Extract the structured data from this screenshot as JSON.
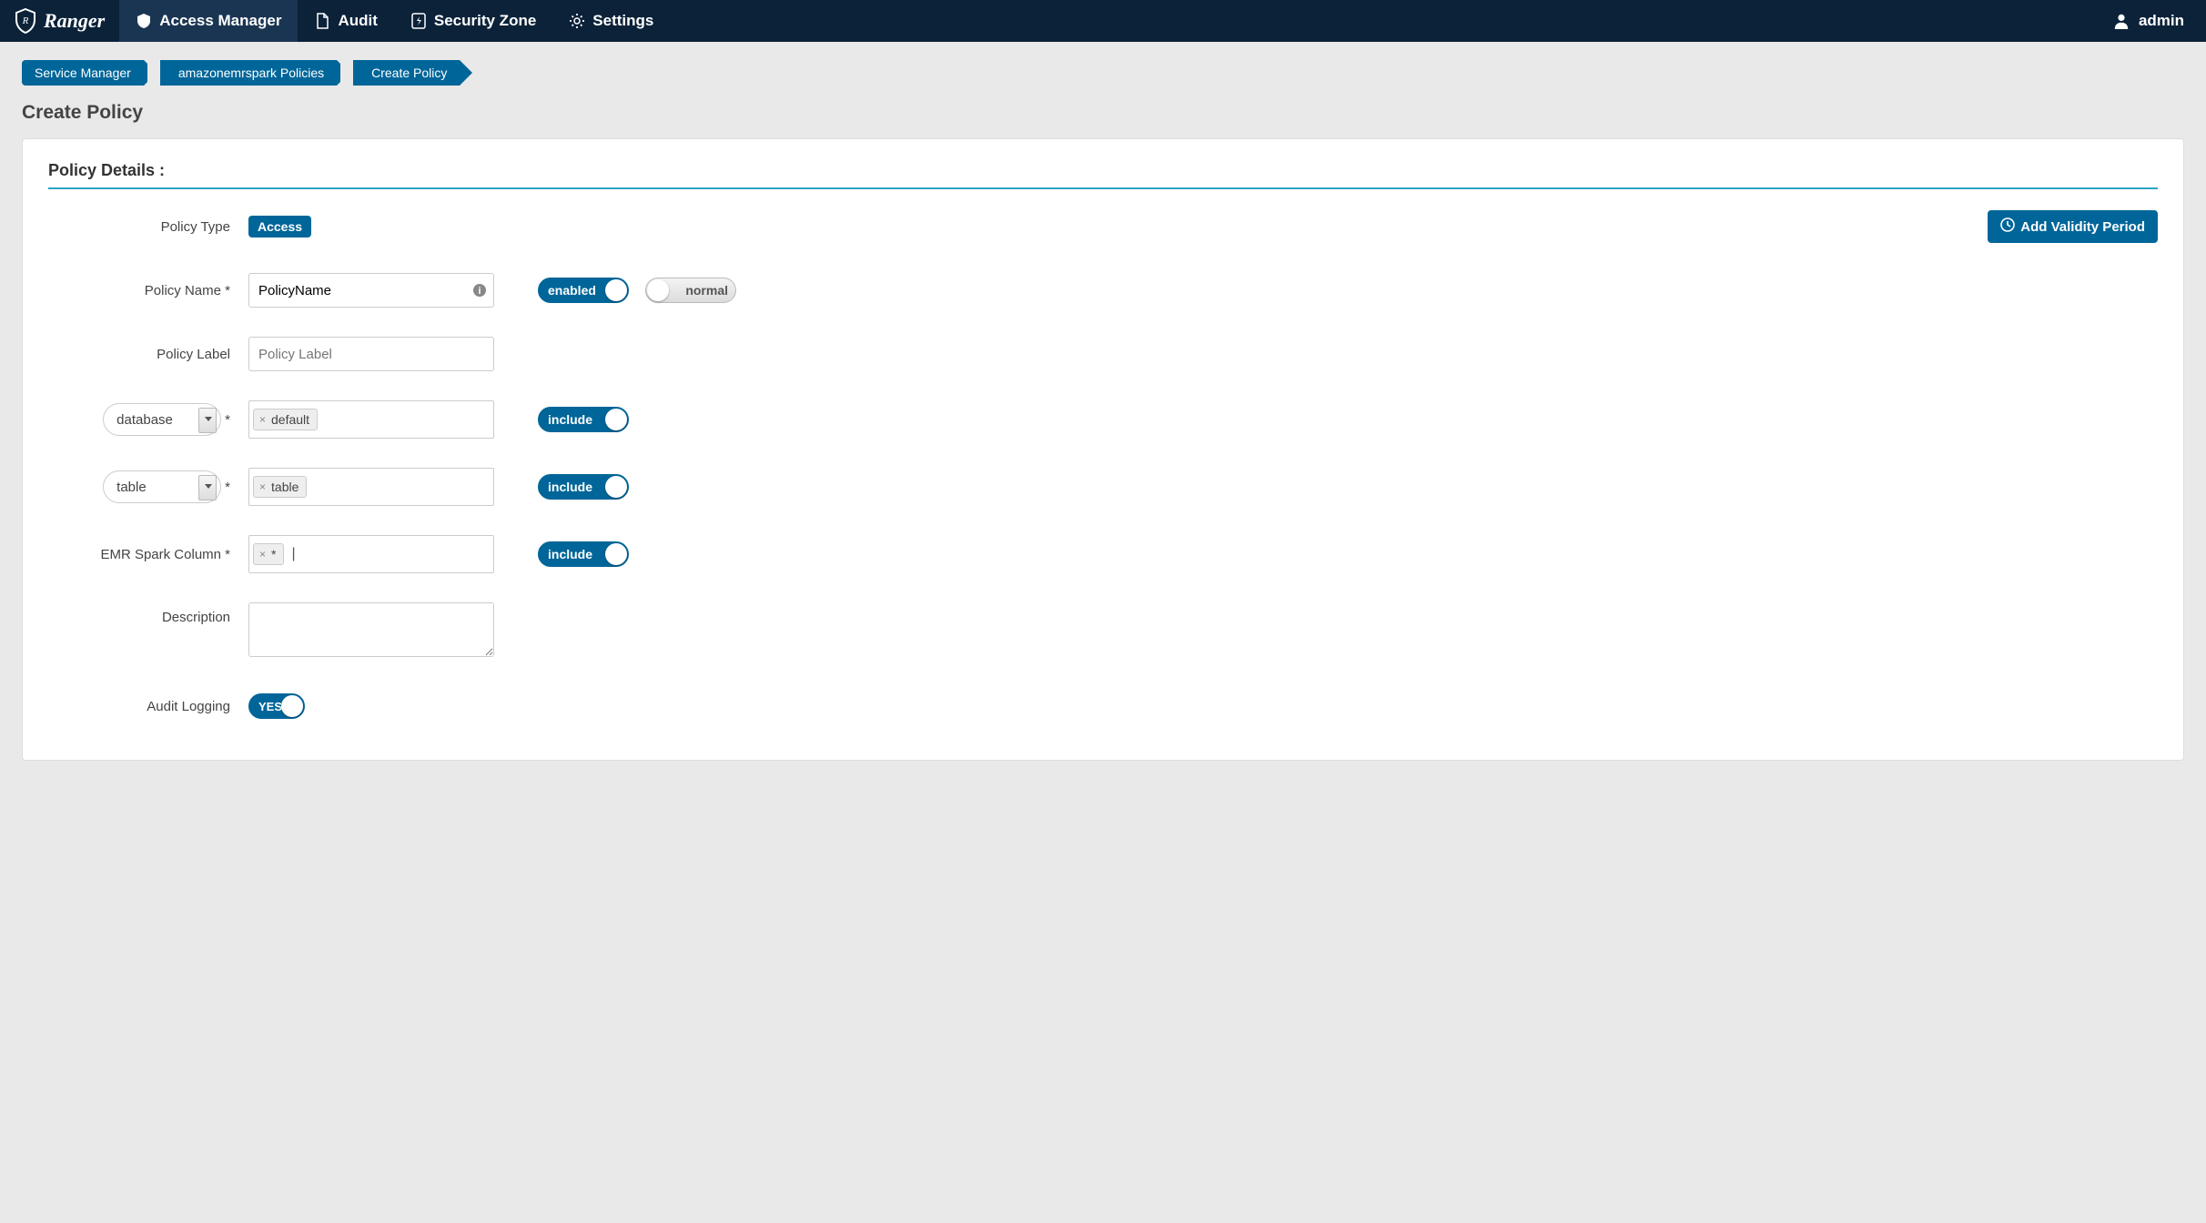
{
  "brand": {
    "name": "Ranger"
  },
  "nav": {
    "items": [
      {
        "label": "Access Manager",
        "icon": "shield"
      },
      {
        "label": "Audit",
        "icon": "document"
      },
      {
        "label": "Security Zone",
        "icon": "bolt"
      },
      {
        "label": "Settings",
        "icon": "gear"
      }
    ],
    "user": "admin"
  },
  "breadcrumbs": [
    "Service Manager",
    "amazonemrspark Policies",
    "Create Policy"
  ],
  "page": {
    "title": "Create Policy"
  },
  "section": {
    "heading": "Policy Details :"
  },
  "buttons": {
    "add_validity": "Add Validity Period"
  },
  "form": {
    "policy_type": {
      "label": "Policy Type",
      "value": "Access"
    },
    "policy_name": {
      "label": "Policy Name *",
      "value": "PolicyName"
    },
    "policy_label": {
      "label": "Policy Label",
      "placeholder": "Policy Label"
    },
    "description": {
      "label": "Description",
      "value": ""
    },
    "audit_logging": {
      "label": "Audit Logging",
      "value": "YES"
    },
    "enabled_toggle": "enabled",
    "normal_toggle": "normal",
    "resources": [
      {
        "selector": "database",
        "tags": [
          "default"
        ],
        "include": "include"
      },
      {
        "selector": "table",
        "tags": [
          "table"
        ],
        "include": "include"
      }
    ],
    "emr_column": {
      "label": "EMR Spark Column *",
      "tags": [
        "*"
      ],
      "include": "include"
    }
  }
}
